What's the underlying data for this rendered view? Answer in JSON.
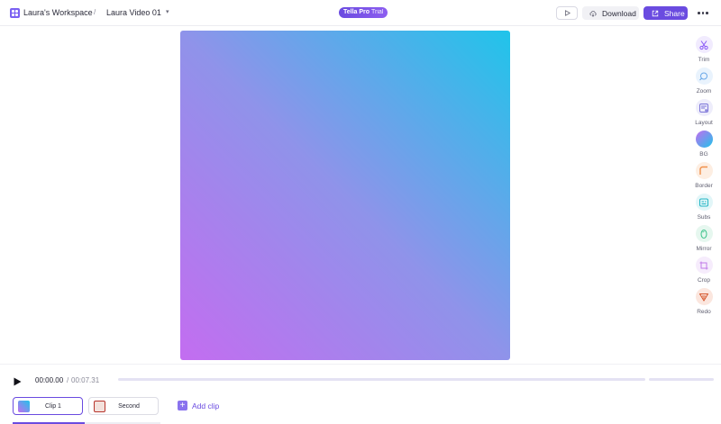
{
  "header": {
    "workspace_name": "Laura's Workspace",
    "breadcrumb_separator": "/",
    "video_title": "Laura Video 01",
    "trial_badge_bold": "Tella Pro",
    "trial_badge_thin": "Trial",
    "download_label": "Download",
    "share_label": "Share"
  },
  "canvas": {
    "background_gradient": [
      "#c36df0",
      "#8f93ea",
      "#20c4ea"
    ]
  },
  "tools": [
    {
      "label": "Trim",
      "icon": "scissors-icon",
      "color": "#8b5cf6"
    },
    {
      "label": "Zoom",
      "icon": "zoom-icon",
      "color": "#6ba8e8"
    },
    {
      "label": "Layout",
      "icon": "layout-icon",
      "color": "#7b74d8"
    },
    {
      "label": "BG",
      "icon": "background-icon",
      "color": "#8f7df0"
    },
    {
      "label": "Border",
      "icon": "border-icon",
      "color": "#f0904a"
    },
    {
      "label": "Subs",
      "icon": "subtitles-icon",
      "color": "#22b5c4"
    },
    {
      "label": "Mirror",
      "icon": "mirror-icon",
      "color": "#3cc28a"
    },
    {
      "label": "Crop",
      "icon": "crop-icon",
      "color": "#c07ae8"
    },
    {
      "label": "Redo",
      "icon": "redo-icon",
      "color": "#d6582e"
    }
  ],
  "player": {
    "current_time": "00:00.00",
    "time_separator": "/",
    "total_time": "00:07.31"
  },
  "clips": [
    {
      "label": "Clip 1",
      "selected": true
    },
    {
      "label": "Second",
      "selected": false
    }
  ],
  "add_clip_label": "Add clip",
  "colors": {
    "accent": "#6a4be0",
    "track": "#e4e2f3"
  }
}
